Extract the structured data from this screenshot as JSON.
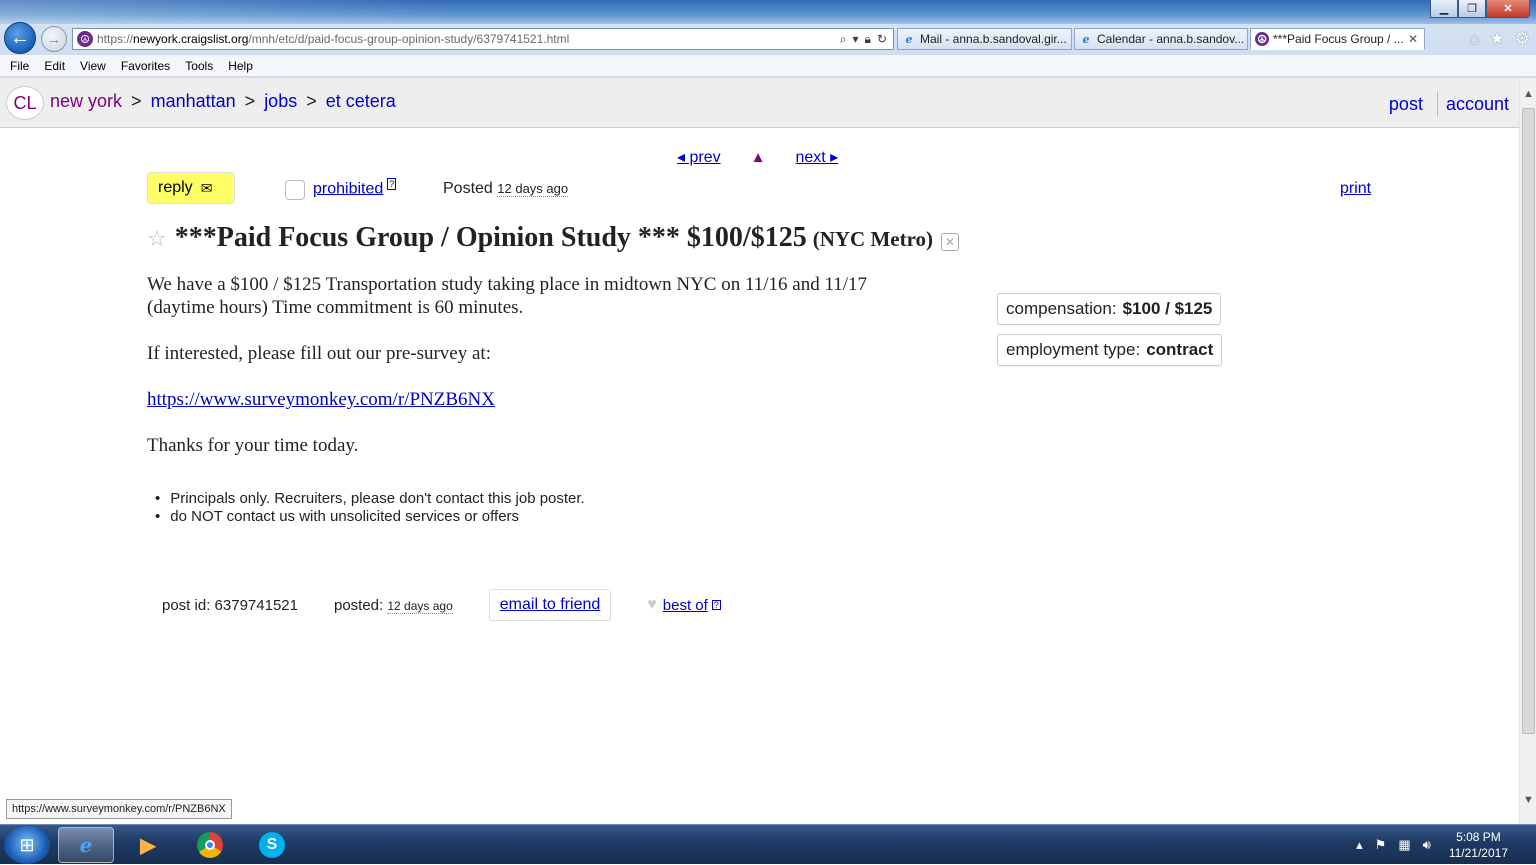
{
  "browser": {
    "url_prefix": "https://",
    "url_domain": "newyork.craigslist.org",
    "url_path": "/mnh/etc/d/paid-focus-group-opinion-study/6379741521.html",
    "tabs": [
      {
        "label": "Mail - anna.b.sandoval.gir..."
      },
      {
        "label": "Calendar - anna.b.sandov..."
      },
      {
        "label": "***Paid Focus Group / ..."
      }
    ],
    "menu": [
      "File",
      "Edit",
      "View",
      "Favorites",
      "Tools",
      "Help"
    ]
  },
  "header": {
    "logo": "CL",
    "breadcrumbs": [
      "new york",
      "manhattan",
      "jobs",
      "et cetera"
    ],
    "separator": ">",
    "post": "post",
    "account": "account"
  },
  "nav": {
    "prev": "◂ prev",
    "up": "▲",
    "next": "next ▸"
  },
  "actions": {
    "reply": "reply",
    "reply_icon": "✉",
    "prohibited": "prohibited",
    "help": "?",
    "posted_label": "Posted",
    "posted_ago": "12 days ago",
    "print": "print"
  },
  "posting": {
    "star": "☆",
    "title": "***Paid Focus Group / Opinion Study *** $100/$125",
    "location": "(NYC Metro)",
    "hide_icon": "✕",
    "body": [
      "We have a $100 / $125 Transportation study taking place in midtown NYC on 11/16 and 11/17 (daytime hours) Time commitment is 60 minutes.",
      "If interested, please fill out our pre-survey at:",
      "https://www.surveymonkey.com/r/PNZB6NX",
      "Thanks for your time today."
    ]
  },
  "attributes": [
    {
      "label": "compensation:",
      "value": "$100 / $125"
    },
    {
      "label": "employment type:",
      "value": "contract"
    }
  ],
  "notices": [
    "Principals only. Recruiters, please don't contact this job poster.",
    "do NOT contact us with unsolicited services or offers"
  ],
  "footer": {
    "post_id_label": "post id:",
    "post_id": "6379741521",
    "posted_label": "posted:",
    "posted_ago": "12 days ago",
    "email_friend": "email to friend",
    "best_of": "best of"
  },
  "status_tip": "https://www.surveymonkey.com/r/PNZB6NX",
  "taskbar": {
    "time": "5:08 PM",
    "date": "11/21/2017"
  }
}
